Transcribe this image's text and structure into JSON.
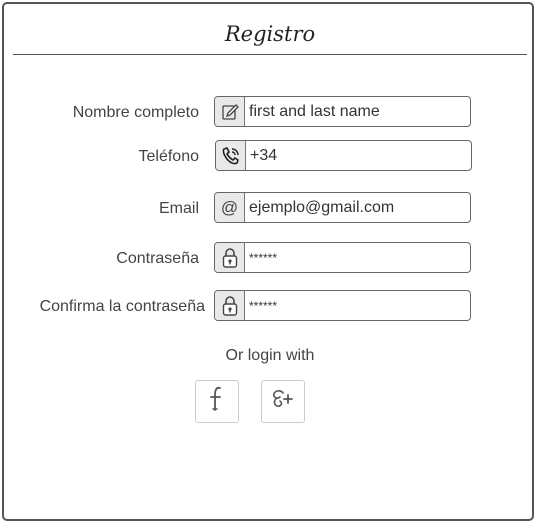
{
  "form": {
    "title": "Registro",
    "fields": [
      {
        "label": "Nombre completo",
        "value": "first and last name",
        "icon": "edit-icon"
      },
      {
        "label": "Teléfono",
        "value": "+34",
        "icon": "phone-icon"
      },
      {
        "label": "Email",
        "value": "ejemplo@gmail.com",
        "icon": "at-icon"
      },
      {
        "label": "Contraseña",
        "value": "******",
        "icon": "lock-icon"
      },
      {
        "label": "Confirma la contraseña",
        "value": "******",
        "icon": "lock-icon"
      }
    ],
    "alt_login_text": "Or login with",
    "social": [
      {
        "icon": "facebook-icon"
      },
      {
        "icon": "google-plus-icon"
      }
    ]
  }
}
